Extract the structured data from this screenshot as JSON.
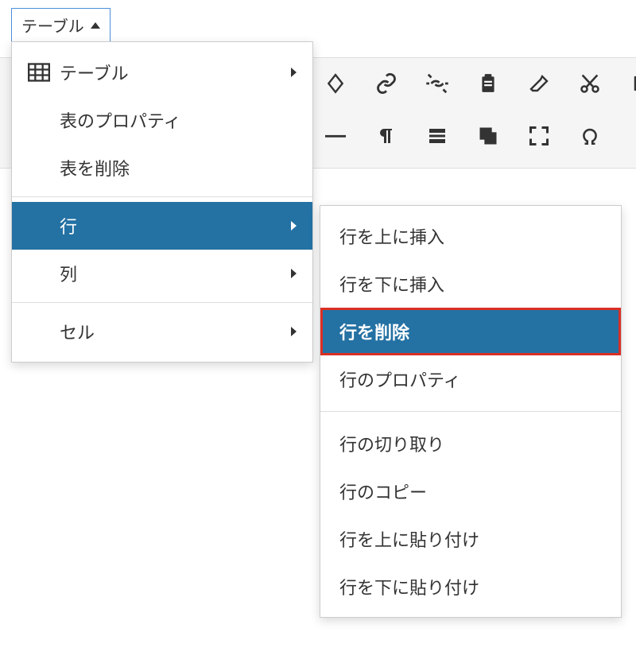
{
  "tab": {
    "label": "テーブル"
  },
  "toolbar": {
    "row1_icons": [
      "diamond-icon",
      "link-icon",
      "unlink-icon",
      "paste-icon",
      "eraser-icon",
      "cut-icon",
      "box-icon"
    ],
    "row2_icons": [
      "minus-icon",
      "paragraph-icon",
      "divider-icon",
      "copy-icon",
      "fullscreen-icon",
      "omega-icon"
    ]
  },
  "menu": {
    "items": [
      {
        "label": "テーブル",
        "has_icon": true,
        "submenu": true,
        "highlighted": false
      },
      {
        "label": "表のプロパティ",
        "has_icon": false,
        "submenu": false,
        "highlighted": false
      },
      {
        "label": "表を削除",
        "has_icon": false,
        "submenu": false,
        "highlighted": false
      },
      {
        "label": "行",
        "has_icon": false,
        "submenu": true,
        "highlighted": true
      },
      {
        "label": "列",
        "has_icon": false,
        "submenu": true,
        "highlighted": false
      },
      {
        "label": "セル",
        "has_icon": false,
        "submenu": true,
        "highlighted": false
      }
    ],
    "separators_after": [
      2,
      4
    ]
  },
  "submenu": {
    "items": [
      {
        "label": "行を上に挿入",
        "highlighted": false
      },
      {
        "label": "行を下に挿入",
        "highlighted": false
      },
      {
        "label": "行を削除",
        "highlighted": true
      },
      {
        "label": "行のプロパティ",
        "highlighted": false
      },
      {
        "label": "行の切り取り",
        "highlighted": false
      },
      {
        "label": "行のコピー",
        "highlighted": false
      },
      {
        "label": "行を上に貼り付け",
        "highlighted": false
      },
      {
        "label": "行を下に貼り付け",
        "highlighted": false
      }
    ],
    "separators_after": [
      3
    ]
  }
}
